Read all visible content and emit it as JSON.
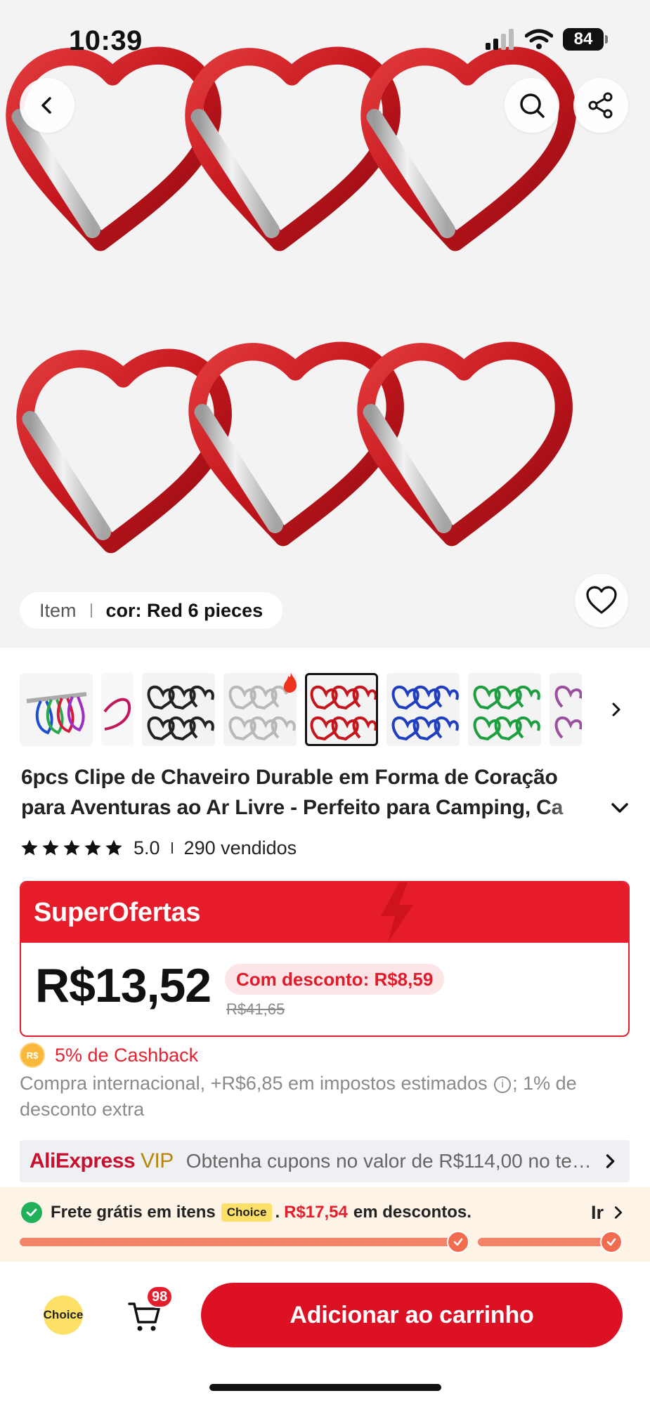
{
  "status_bar": {
    "time": "10:39",
    "battery": "84"
  },
  "hero": {
    "item_label": "Item",
    "item_value": "cor: Red 6 pieces",
    "icons": [
      "chevron-left-icon",
      "search-icon",
      "share-icon",
      "heart-icon"
    ]
  },
  "thumbnails": [
    {
      "name": "multicolor"
    },
    {
      "name": "pink"
    },
    {
      "name": "black"
    },
    {
      "name": "silver"
    },
    {
      "name": "red",
      "selected": true
    },
    {
      "name": "blue"
    },
    {
      "name": "green"
    },
    {
      "name": "purple"
    }
  ],
  "product": {
    "title_line1": "6pcs Clipe de Chaveiro Durable em Forma de Coração",
    "title_line2": "para Aventuras ao Ar Livre - Perfeito para Camping, Ca",
    "rating": "5.0",
    "sold": "290 vendidos"
  },
  "offer": {
    "banner": "SuperOfertas",
    "price": "R$13,52",
    "discount": "Com desconto: R$8,59",
    "original_price": "R$41,65"
  },
  "cashback": {
    "coin": "R$",
    "text": "5% de Cashback"
  },
  "tax_note": {
    "before": "Compra internacional, +R$6,85 em impostos estimados",
    "info": "i",
    "after": "; 1% de desconto extra"
  },
  "vip": {
    "logo": "AliExpress",
    "logo_vip": "VIP",
    "text": "Obtenha cupons no valor de R$114,00 no test..."
  },
  "free_shipping": {
    "text_a": "Frete grátis em itens",
    "chip": "Choice",
    "dot": ".",
    "amount": "R$17,54",
    "text_b": "em descontos.",
    "go": "Ir"
  },
  "bottom": {
    "choice": "Choice",
    "cart_count": "98",
    "add_to_cart": "Adicionar ao carrinho"
  },
  "colors": {
    "accent_red": "#e41f2d",
    "button_red": "#dc1224",
    "choice_yellow": "#fde068",
    "progress_orange": "#f26d4f",
    "success_green": "#21b15b"
  }
}
